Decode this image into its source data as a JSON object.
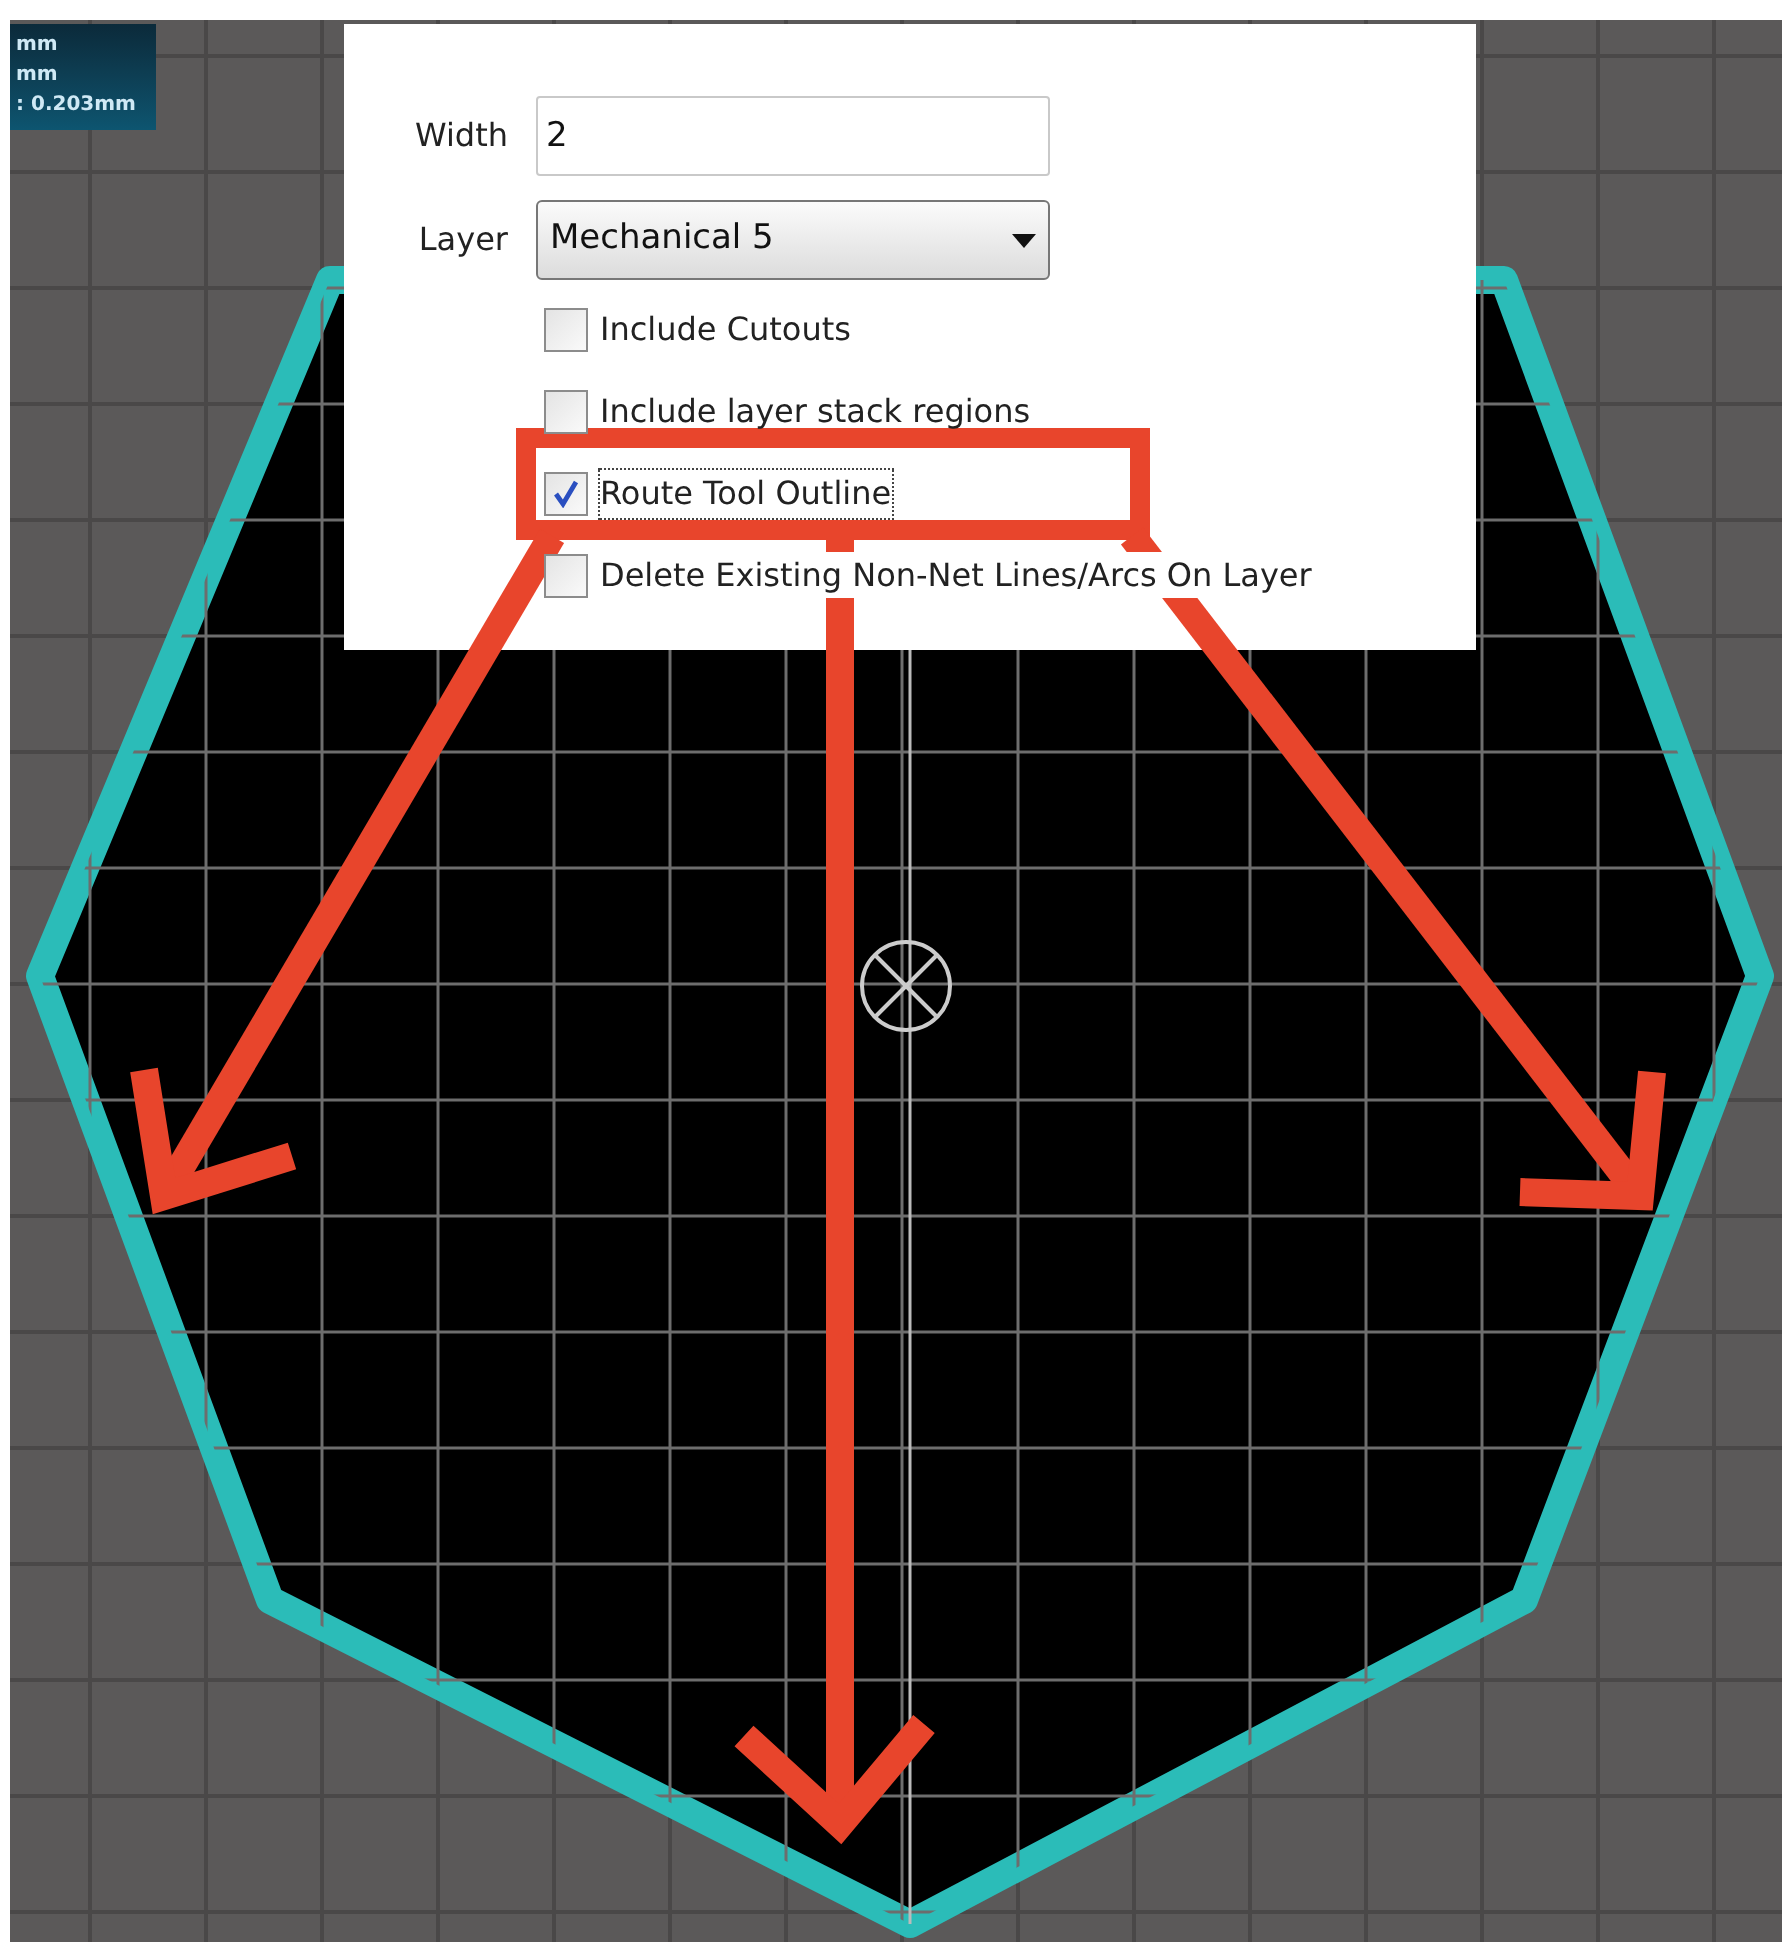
{
  "readout": {
    "lines": [
      "mm",
      "mm",
      ": 0.203mm"
    ]
  },
  "dialog": {
    "width": {
      "label": "Width",
      "value": "2"
    },
    "layer": {
      "label": "Layer",
      "value": "Mechanical 5"
    },
    "options": [
      {
        "label": "Include Cutouts",
        "checked": false
      },
      {
        "label": "Include layer stack regions",
        "checked": false
      },
      {
        "label": "Route Tool Outline",
        "checked": true
      },
      {
        "label": "Delete Existing Non-Net Lines/Arcs On Layer",
        "checked": false
      }
    ]
  }
}
